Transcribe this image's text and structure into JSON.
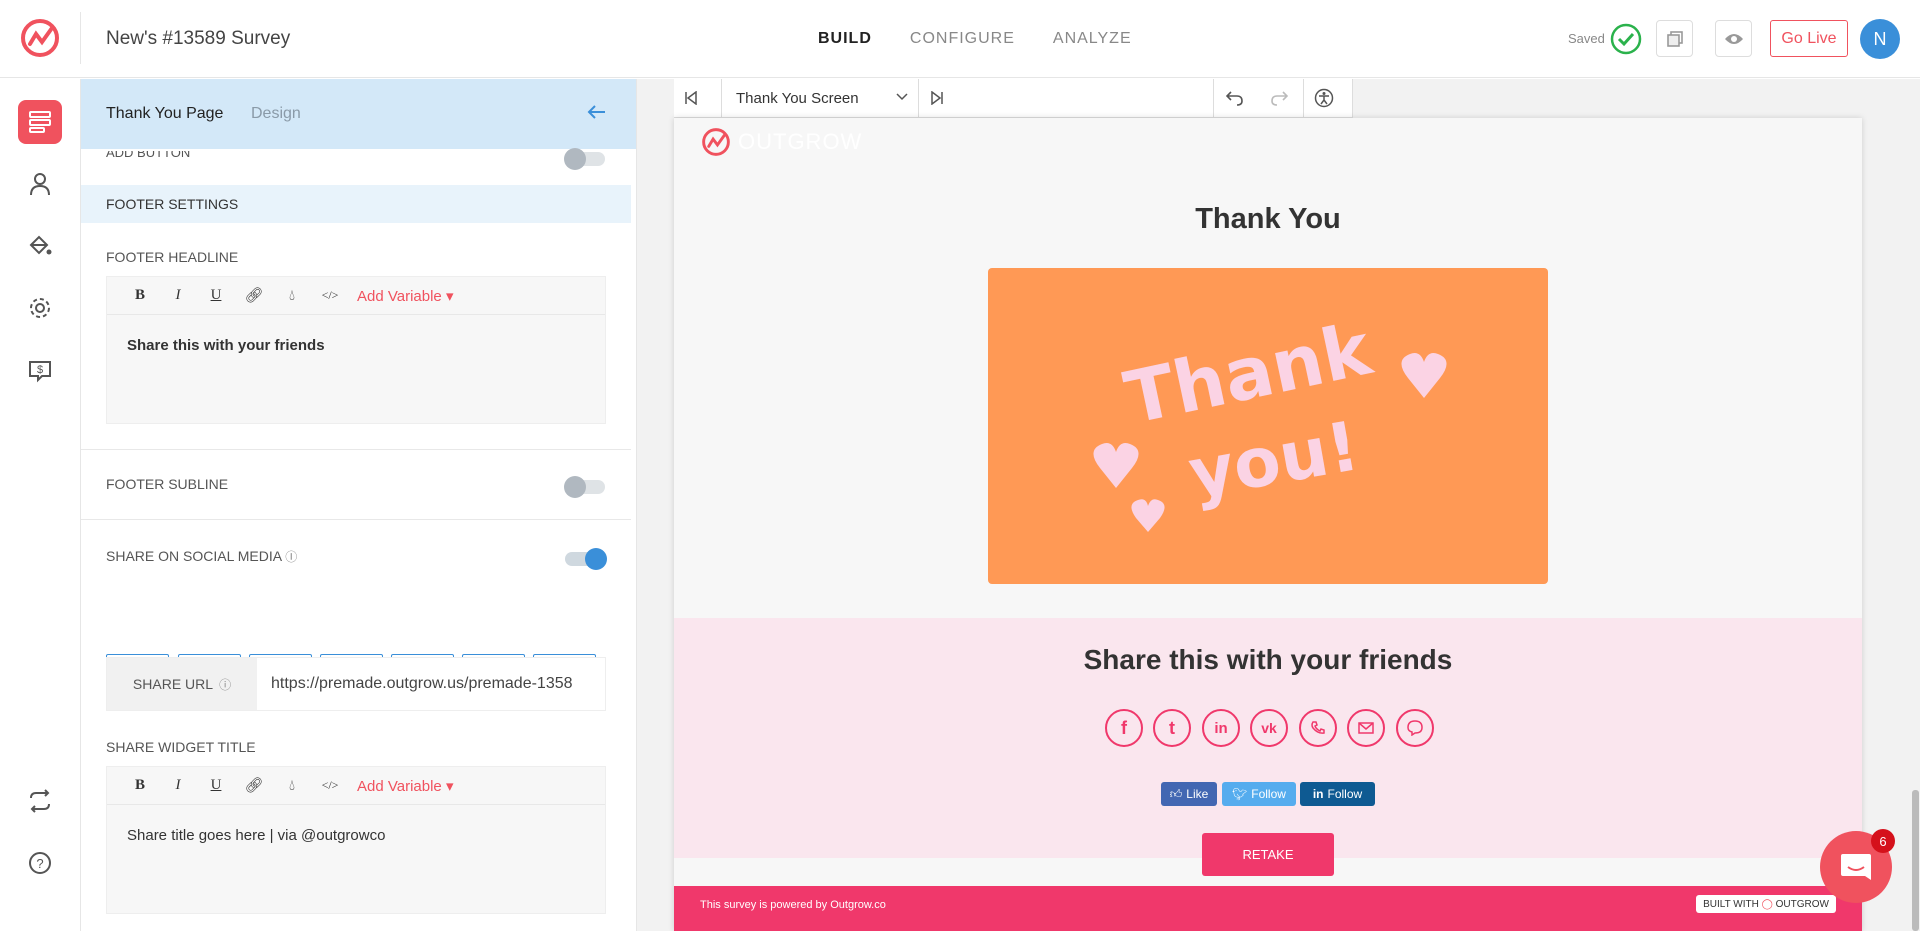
{
  "app": {
    "title": "New's #13589 Survey",
    "nav_tabs": [
      {
        "label": "BUILD",
        "active": true
      },
      {
        "label": "CONFIGURE",
        "active": false
      },
      {
        "label": "ANALYZE",
        "active": false
      }
    ],
    "saved_label": "Saved",
    "go_live_label": "Go Live",
    "avatar_initial": "N",
    "accent_color": "#f0525e",
    "blue_color": "#3a8fd9"
  },
  "left_nav": [
    {
      "icon": "build-icon",
      "active": true
    },
    {
      "icon": "user-icon"
    },
    {
      "icon": "paint-bucket-icon"
    },
    {
      "icon": "gear-icon"
    },
    {
      "icon": "dollar-chat-icon"
    },
    {
      "icon": "swap-icon"
    },
    {
      "icon": "help-icon"
    }
  ],
  "panel": {
    "tabs": {
      "primary": "Thank You Page",
      "secondary": "Design"
    },
    "add_button_label": "ADD BUTTON",
    "footer_settings_label": "FOOTER SETTINGS",
    "footer_headline_label": "FOOTER HEADLINE",
    "editor_add_variable": "Add Variable",
    "footer_headline_text": "Share this with your friends",
    "footer_subline_label": "FOOTER SUBLINE",
    "share_social_label": "SHARE ON SOCIAL MEDIA",
    "social_buttons": [
      "facebook-icon",
      "twitter-icon",
      "linkedin-icon",
      "vk-icon",
      "whatsapp-icon",
      "email-icon",
      "messenger-icon"
    ],
    "share_url_label": "SHARE URL",
    "share_url_value": "https://premade.outgrow.us/premade-1358",
    "share_widget_title_label": "SHARE WIDGET TITLE",
    "share_widget_title_text": "Share title goes here | via @outgrowco"
  },
  "canvas": {
    "screen_select": "Thank You Screen"
  },
  "preview": {
    "logo_text": "OUTGROW",
    "heading": "Thank You",
    "share_title": "Share this with your friends",
    "like_label": "Like",
    "follow_twitter_label": "Follow",
    "follow_linkedin_label": "Follow",
    "retake_label": "RETAKE",
    "footer_text": "This survey is powered by Outgrow.co",
    "built_with_label": "BUILT WITH",
    "built_with_brand": "OUTGROW",
    "share_color": "#f0386b",
    "image_bg": "#ff9955"
  },
  "chat": {
    "badge_count": "6"
  }
}
